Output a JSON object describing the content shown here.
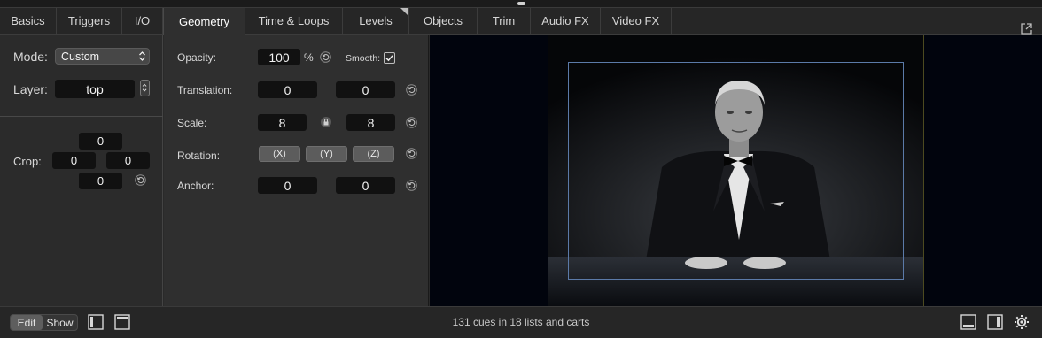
{
  "tabs": [
    {
      "label": "Basics"
    },
    {
      "label": "Triggers"
    },
    {
      "label": "I/O"
    },
    {
      "label": "Geometry",
      "active": true
    },
    {
      "label": "Time & Loops"
    },
    {
      "label": "Levels"
    },
    {
      "label": "Objects"
    },
    {
      "label": "Trim"
    },
    {
      "label": "Audio FX"
    },
    {
      "label": "Video FX"
    }
  ],
  "left": {
    "mode_label": "Mode:",
    "mode_value": "Custom",
    "layer_label": "Layer:",
    "layer_value": "top",
    "crop_label": "Crop:",
    "crop": {
      "top": "0",
      "left": "0",
      "right": "0",
      "bottom": "0"
    }
  },
  "geometry": {
    "opacity_label": "Opacity:",
    "opacity_value": "100",
    "opacity_unit": "%",
    "smooth_label": "Smooth:",
    "smooth_checked": true,
    "translation_label": "Translation:",
    "translation_x": "0",
    "translation_y": "0",
    "scale_label": "Scale:",
    "scale_x": "8",
    "scale_y": "8",
    "rotation_label": "Rotation:",
    "rotation_buttons": [
      "X",
      "Y",
      "Z"
    ],
    "anchor_label": "Anchor:",
    "anchor_x": "0",
    "anchor_y": "0"
  },
  "bottom": {
    "edit_label": "Edit",
    "show_label": "Show",
    "status_text": "131 cues in 18 lists and carts"
  },
  "colors": {
    "stage_border": "#5b7aa8",
    "video_bg": "#01040d"
  }
}
